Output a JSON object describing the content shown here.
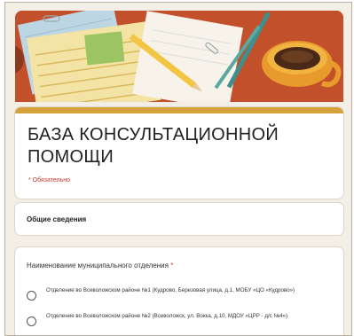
{
  "form": {
    "title": "БАЗА КОНСУЛЬТАЦИОННОЙ ПОМОЩИ",
    "required_note": "* Обязательно",
    "section_title": "Общие сведения",
    "question": {
      "label": "Наименование муниципального отделения",
      "required_mark": "*",
      "options": [
        {
          "label": "Отделение во Всеволожском районе №1 (Кудрово, Березовая улица, д.1, МОБУ «ЦО «Кудрово»)",
          "selected": false
        },
        {
          "label": "Отделение во Всеволожском районе №2 (Всеволожск, ул. Вокка, д.10, МДОУ «ЦРР - д/с №4»)",
          "selected": false
        }
      ]
    }
  },
  "colors": {
    "banner_bg": "#c9552f",
    "accent": "#d4a23a",
    "required": "#c0392b"
  }
}
